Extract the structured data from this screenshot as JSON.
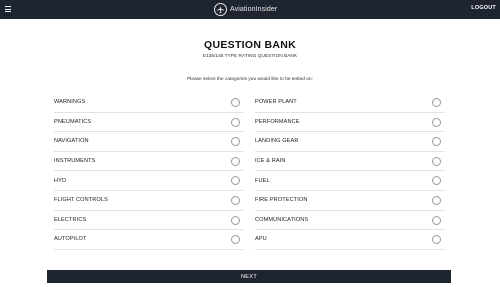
{
  "header": {
    "brand": "AviationInsider",
    "logout_label": "LOGOUT"
  },
  "page": {
    "title": "QUESTION BANK",
    "subtitle": "E135/145 TYPE RATING QUESTION BANK",
    "instructions": "Please select the categories you would like to be tested on:"
  },
  "categories": {
    "left": [
      {
        "label": "WARNINGS",
        "selected": false
      },
      {
        "label": "PNEUMATICS",
        "selected": false
      },
      {
        "label": "NAVIGATION",
        "selected": false
      },
      {
        "label": "INSTRUMENTS",
        "selected": false
      },
      {
        "label": "HYD",
        "selected": false
      },
      {
        "label": "FLIGHT CONTROLS",
        "selected": false
      },
      {
        "label": "ELECTRICS",
        "selected": false
      },
      {
        "label": "AUTOPILOT",
        "selected": false
      }
    ],
    "right": [
      {
        "label": "POWER PLANT",
        "selected": false
      },
      {
        "label": "PERFORMANCE",
        "selected": false
      },
      {
        "label": "LANDING GEAR",
        "selected": false
      },
      {
        "label": "ICE & RAIN",
        "selected": false
      },
      {
        "label": "FUEL",
        "selected": false
      },
      {
        "label": "FIRE PROTECTION",
        "selected": false
      },
      {
        "label": "COMMUNICATIONS",
        "selected": false
      },
      {
        "label": "APU",
        "selected": false
      }
    ]
  },
  "actions": {
    "next_label": "NEXT"
  },
  "colors": {
    "header_bg": "#1f2530",
    "button_bg": "#1f2530",
    "divider": "#e2e2e2"
  }
}
